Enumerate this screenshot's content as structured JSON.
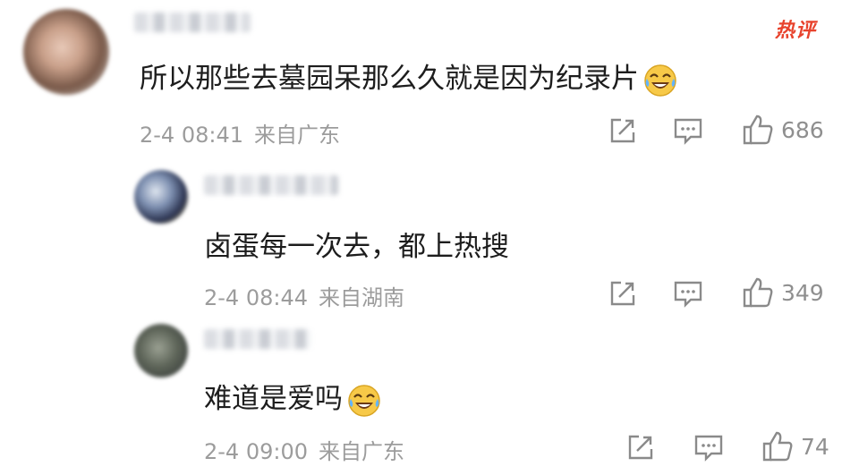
{
  "hot_badge": "热评",
  "comments": [
    {
      "content": "所以那些去墓园呆那么久就是因为纪录片",
      "emoji": "laughing-crying-emoji",
      "date": "2-4 08:41",
      "location": "来自广东",
      "likes": "686"
    },
    {
      "content": "卤蛋每一次去，都上热搜",
      "date": "2-4 08:44",
      "location": "来自湖南",
      "likes": "349"
    },
    {
      "content": "难道是爱吗",
      "emoji": "laughing-crying-emoji",
      "date": "2-4 09:00",
      "location": "来自广东",
      "likes": "74"
    }
  ],
  "icons": {
    "repost": "repost-icon",
    "comment": "comment-icon",
    "like": "thumbs-up-icon"
  },
  "colors": {
    "badge": "#e8432d",
    "meta": "#9c9c9c",
    "text": "#1d1d1d",
    "icon": "#8a8a8a",
    "emoji_face": "#f7c948"
  }
}
